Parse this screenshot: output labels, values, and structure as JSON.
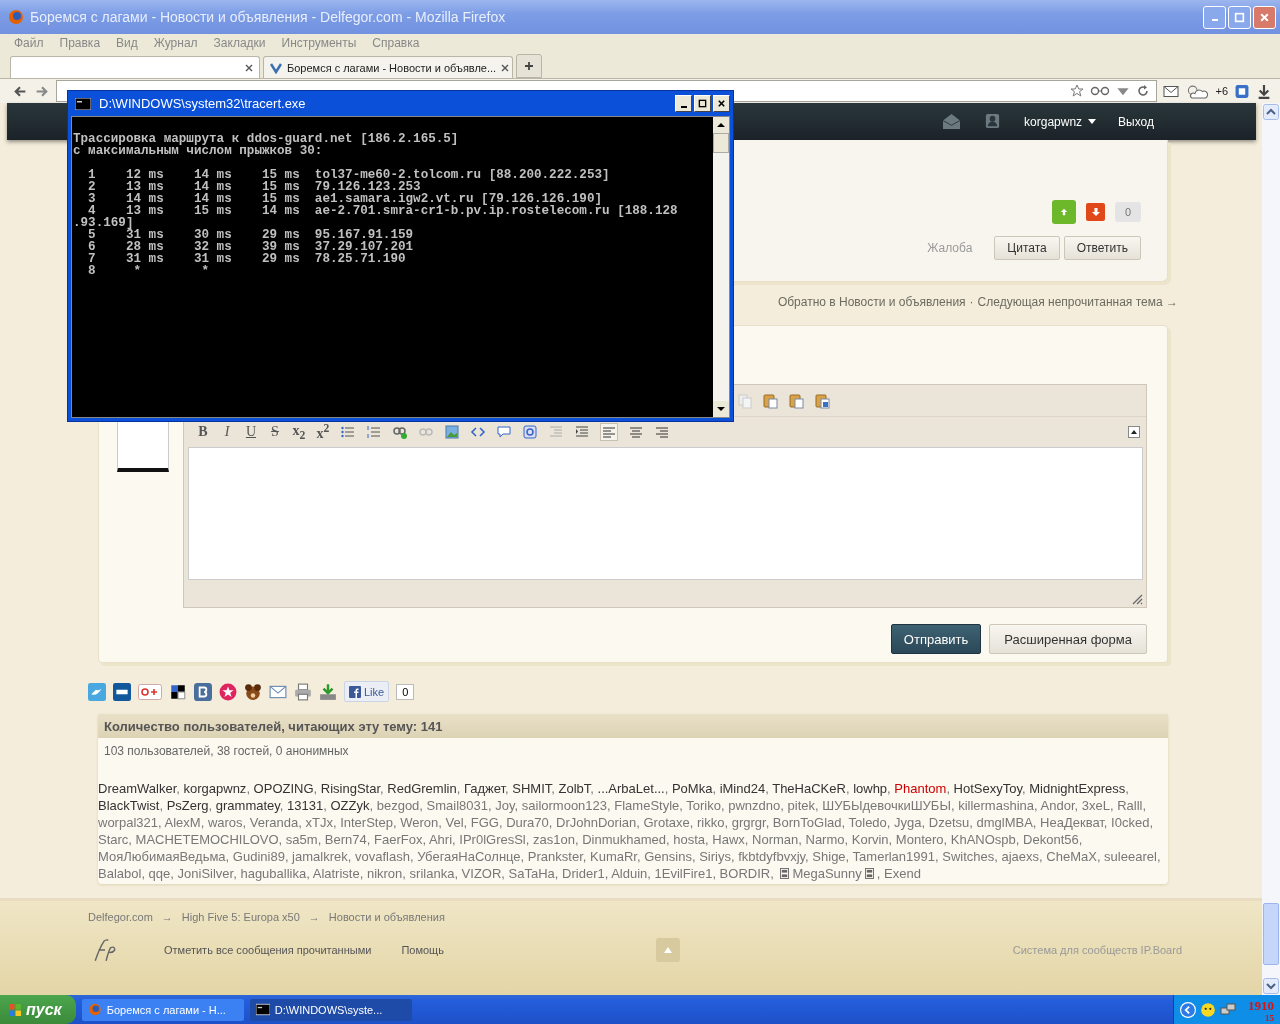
{
  "browser": {
    "title": "Боремся с лагами - Новости и объявления - Delfegor.com - Mozilla Firefox",
    "menu": [
      "Файл",
      "Правка",
      "Вид",
      "Журнал",
      "Закладки",
      "Инструменты",
      "Справка"
    ],
    "tabs": [
      {
        "selected": false
      },
      {
        "label": "Боремся с лагами - Новости и объявле...",
        "selected": true
      }
    ],
    "weather_badge": "+6"
  },
  "forum": {
    "header": {
      "username": "korgapwnz",
      "logout": "Выход"
    },
    "post": {
      "rating": "0",
      "report": "Жалоба",
      "buttons": [
        "Цитата",
        "Ответить"
      ]
    },
    "topic_nav": {
      "back": "Обратно в Новости и объявления",
      "separator": "·",
      "next": "Следующая непрочитанная тема →"
    },
    "editor": {
      "format_buttons": [
        "B",
        "I",
        "U",
        "S",
        "x$_{2}$",
        "x$^{2}$"
      ],
      "submit": "Отправить",
      "advanced": "Расширенная форма"
    },
    "share": {
      "like": "Like",
      "like_count": "0"
    },
    "readers": {
      "title": "Количество пользователей, читающих эту тему: 141",
      "summary": "103 пользователей, 38 гостей, 0 анонимных",
      "separator": ", ",
      "groups": [
        {
          "color": "#333333",
          "marked": false,
          "names": [
            "DreamWalker",
            "korgapwnz",
            "OPOZING",
            "RisingStar",
            "RedGremlin",
            "Гаджет",
            "SHMIT",
            "ZolbT",
            "...ArbaLet...",
            "PoMka",
            "iMind24",
            "TheHaCKeR",
            "lowhp"
          ]
        },
        {
          "color": "#cc0000",
          "marked": false,
          "names": [
            "Phantom"
          ]
        },
        {
          "color": "#333333",
          "marked": false,
          "names": [
            "HotSexyToy",
            "MidnightExpress",
            "BlackTwist",
            "PsZerg",
            "grammatey",
            "13131",
            "OZZyk"
          ]
        },
        {
          "color": "#777777",
          "marked": false,
          "names": [
            "bezgod",
            "Smail8031",
            "Joy",
            "sailormoon123",
            "FlameStyle",
            "Toriko",
            "pwnzdno",
            "pitek",
            "ШУБЫдевочкиШУБЫ",
            "killermashina",
            "Andor",
            "3xeL",
            "Ralll",
            "worpal321",
            "AlexM",
            "waros",
            "Veranda",
            "xTJx",
            "InterStep",
            "Weron",
            "Vel",
            "FGG",
            "Dura70",
            "DrJohnDorian",
            "Grotaxe",
            "rikko",
            "grgrgr",
            "BornToGlad",
            "Toledo",
            "Jyga",
            "Dzetsu",
            "dmglMBA",
            "НеаДекват",
            "I0cked",
            "Starc",
            "MACHETEMOCHILOVO",
            "sa5m",
            "Bern74",
            "FaerFox",
            "Ahri",
            "IPr0lGresSl",
            "zas1on",
            "Dinmukhamed",
            "hosta",
            "Hawx",
            "Norman",
            "Narmo",
            "Korvin",
            "Montero",
            "KhANOspb",
            "Dekont56",
            "МояЛюбимаяВедьма",
            "Gudini89",
            "jamalkrek",
            "vovaflash",
            "УбегаяНаСолнце",
            "Prankster",
            "KumaRr",
            "Gensins",
            "Siriys",
            "fkbtdyfbvxjy",
            "Shige",
            "Tamerlan1991",
            "Switches",
            "ajaexs",
            "CheMaX",
            "suleearel",
            "Balabol",
            "qqe",
            "JoniSilver",
            "haguballika",
            "Alatriste",
            "nikron",
            "srilanka",
            "VIZOR",
            "SaTaHa",
            "Drider1",
            "Alduin",
            "1EvilFire1",
            "BORDIR"
          ]
        },
        {
          "color": "#777777",
          "marked": true,
          "names": [
            "MegaSunny"
          ]
        },
        {
          "color": "#777777",
          "marked": false,
          "names": [
            "Exend"
          ]
        }
      ]
    },
    "footer": {
      "breadcrumbs": [
        "Delfegor.com",
        "High Five 5: Europa x50",
        "Новости и объявления"
      ],
      "breadcrumb_separator": "→",
      "links": [
        "Отметить все сообщения прочитанными",
        "Помощь"
      ],
      "powered": "Система для сообществ IP.Board"
    }
  },
  "console": {
    "title": "D:\\WINDOWS\\system32\\tracert.exe",
    "blocks": [
      [
        "Трассировка маршрута к ddos-guard.net [186.2.165.5]",
        "с максимальным числом прыжков 30:"
      ],
      [
        "  1    12 ms    14 ms    15 ms  tol37-me60-2.tolcom.ru [88.200.222.253]",
        "  2    13 ms    14 ms    15 ms  79.126.123.253",
        "  3    14 ms    14 ms    15 ms  ae1.samara.igw2.vt.ru [79.126.126.190]",
        "  4    13 ms    15 ms    14 ms  ae-2.701.smra-cr1-b.pv.ip.rostelecom.ru [188.128",
        ".93.169]",
        "  5    31 ms    30 ms    29 ms  95.167.91.159",
        "  6    28 ms    32 ms    39 ms  37.29.107.201",
        "  7    31 ms    31 ms    29 ms  78.25.71.190",
        "  8     *        *"
      ]
    ]
  },
  "taskbar": {
    "start": "пуск",
    "tasks": [
      {
        "label": "Боремся с лагами - Н...",
        "selected": false
      },
      {
        "label": "D:\\WINDOWS\\syste...",
        "selected": true
      }
    ],
    "clock": [
      "1910",
      "15"
    ]
  }
}
